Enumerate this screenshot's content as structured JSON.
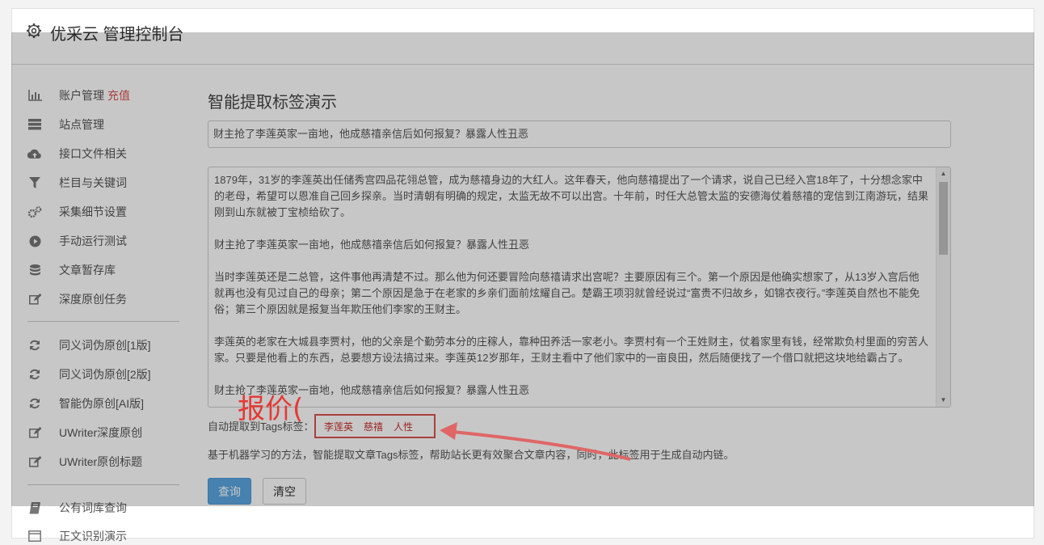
{
  "app": {
    "title": "优采云 管理控制台"
  },
  "sidebar": {
    "items": [
      {
        "label": "账户管理",
        "accent": "充值",
        "icon": "bar-chart-icon"
      },
      {
        "label": "站点管理",
        "icon": "server-icon"
      },
      {
        "label": "接口文件相关",
        "icon": "cloud-upload-icon"
      },
      {
        "label": "栏目与关键词",
        "icon": "filter-icon"
      },
      {
        "label": "采集细节设置",
        "icon": "gears-icon"
      },
      {
        "label": "手动运行测试",
        "icon": "play-circle-icon"
      },
      {
        "label": "文章暂存库",
        "icon": "database-icon"
      },
      {
        "label": "深度原创任务",
        "icon": "edit-icon"
      },
      {
        "label": "同义词伪原创[1版]",
        "icon": "refresh-icon"
      },
      {
        "label": "同义词伪原创[2版]",
        "icon": "refresh-icon"
      },
      {
        "label": "智能伪原创[AI版]",
        "icon": "refresh-icon"
      },
      {
        "label": "UWriter深度原创",
        "icon": "edit-icon"
      },
      {
        "label": "UWriter原创标题",
        "icon": "edit-icon"
      },
      {
        "label": "公有词库查询",
        "icon": "book-icon"
      },
      {
        "label": "正文识别演示",
        "icon": "window-icon"
      }
    ]
  },
  "main": {
    "heading": "智能提取标签演示",
    "title_value": "财主抢了李莲英家一亩地，他成慈禧亲信后如何报复？暴露人性丑恶",
    "article_paragraphs": [
      "1879年，31岁的李莲英出任储秀宫四品花翎总管，成为慈禧身边的大红人。这年春天，他向慈禧提出了一个请求，说自己已经入宫18年了，十分想念家中的老母，希望可以恩准自己回乡探亲。当时清朝有明确的规定，太监无故不可以出宫。十年前，时任大总管太监的安德海仗着慈禧的宠信到江南游玩，结果刚到山东就被丁宝桢给砍了。",
      "财主抢了李莲英家一亩地，他成慈禧亲信后如何报复？暴露人性丑恶",
      "当时李莲英还是二总管，这件事他再清楚不过。那么他为何还要冒险向慈禧请求出宫呢？主要原因有三个。第一个原因是他确实想家了，从13岁入宫后他就再也没有见过自己的母亲；第二个原因是急于在老家的乡亲们面前炫耀自己。楚霸王项羽就曾经说过“富贵不归故乡，如锦衣夜行。”李莲英自然也不能免俗；第三个原因就是报复当年欺压他们李家的王财主。",
      "李莲英的老家在大城县李贾村，他的父亲是个勤劳本分的庄稼人，靠种田养活一家老小。李贾村有一个王姓财主，仗着家里有钱，经常欺负村里面的穷苦人家。只要是他看上的东西，总要想方设法搞过来。李莲英12岁那年，王财主看中了他们家中的一亩良田，然后随便找了一个借口就把这块地给霸占了。",
      "财主抢了李莲英家一亩地，他成慈禧亲信后如何报复？暴露人性丑恶"
    ],
    "tags_label": "自动提取到Tags标签：",
    "tags": [
      "李莲英",
      "慈禧",
      "人性"
    ],
    "description": "基于机器学习的方法，智能提取文章Tags标签，帮助站长更有效聚合文章内容，同时，此标签用于生成自动内链。",
    "query_button": "查询",
    "clear_button": "清空"
  },
  "annotation": {
    "text": "报价(",
    "color": "#e53935"
  }
}
